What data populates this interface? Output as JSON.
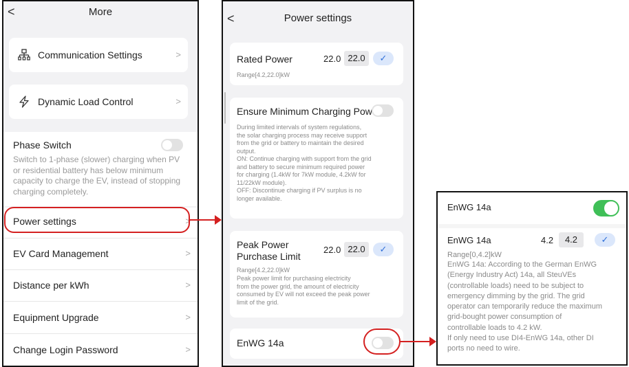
{
  "panel1": {
    "back_glyph": "<",
    "title": "More",
    "items": [
      {
        "label": "Communication Settings",
        "icon": "network-icon"
      },
      {
        "label": "Dynamic Load Control",
        "icon": "lightning-icon"
      }
    ],
    "phase_switch": {
      "label": "Phase Switch",
      "enabled": false,
      "description": "Switch to 1-phase (slower) charging when PV or residential battery has below minimum capacity to charge the EV, instead of stopping charging completely."
    },
    "list": [
      {
        "label": "Power settings"
      },
      {
        "label": "EV Card Management"
      },
      {
        "label": "Distance per kWh"
      },
      {
        "label": "Equipment Upgrade"
      },
      {
        "label": "Change Login Password"
      }
    ],
    "chevron": ">"
  },
  "panel2": {
    "back_glyph": "<",
    "title": "Power settings",
    "rated_power": {
      "label": "Rated Power",
      "current": "22.0",
      "input": "22.0",
      "range": "Range[4.2,22.0]kW"
    },
    "ensure_min": {
      "label": "Ensure Minimum Charging Power",
      "enabled": false,
      "desc_lines": [
        "During limited intervals of system regulations,",
        "the solar charging process may receive support",
        "from the grid or battery to maintain the desired",
        "output.",
        "ON: Continue charging with support from the grid",
        "and battery to secure minimum required power",
        "for charging (1.4kW for 7kW module, 4.2kW for",
        "11/22kW module).",
        "OFF:  Discontinue charging if PV surplus is no",
        "longer available."
      ]
    },
    "peak_power": {
      "label_line1": "Peak Power",
      "label_line2": "Purchase Limit",
      "current": "22.0",
      "input": "22.0",
      "range": "Range[4.2,22.0]kW",
      "desc_lines": [
        "Peak power limit for purchasing electricity",
        "from the power grid, the amount of electricity",
        "consumed by EV will not exceed the peak power",
        "limit of the grid."
      ]
    },
    "enwg": {
      "label": "EnWG 14a",
      "enabled": false
    }
  },
  "panel3": {
    "toggle_row": {
      "label": "EnWG 14a",
      "enabled": true
    },
    "value_row": {
      "label": "EnWG 14a",
      "current": "4.2",
      "input": "4.2"
    },
    "range": "Range[0,4.2]kW",
    "desc_lines": [
      "EnWG 14a: According to the German EnWG",
      "(Energy Industry Act) 14a, all SteuVEs",
      "(controllable loads) need to be subject to",
      "emergency dimming by the grid. The grid",
      "operator can temporarily reduce the maximum",
      "grid-bought power consumption of",
      "controllable loads to 4.2 kW.",
      "If only need to use DI4-EnWG 14a, other DI",
      "ports no need to wire."
    ]
  },
  "check_glyph": "✓",
  "colors": {
    "highlight": "#d42020",
    "toggle_on": "#3fbf57",
    "accent_blue": "#2f6fd8"
  }
}
